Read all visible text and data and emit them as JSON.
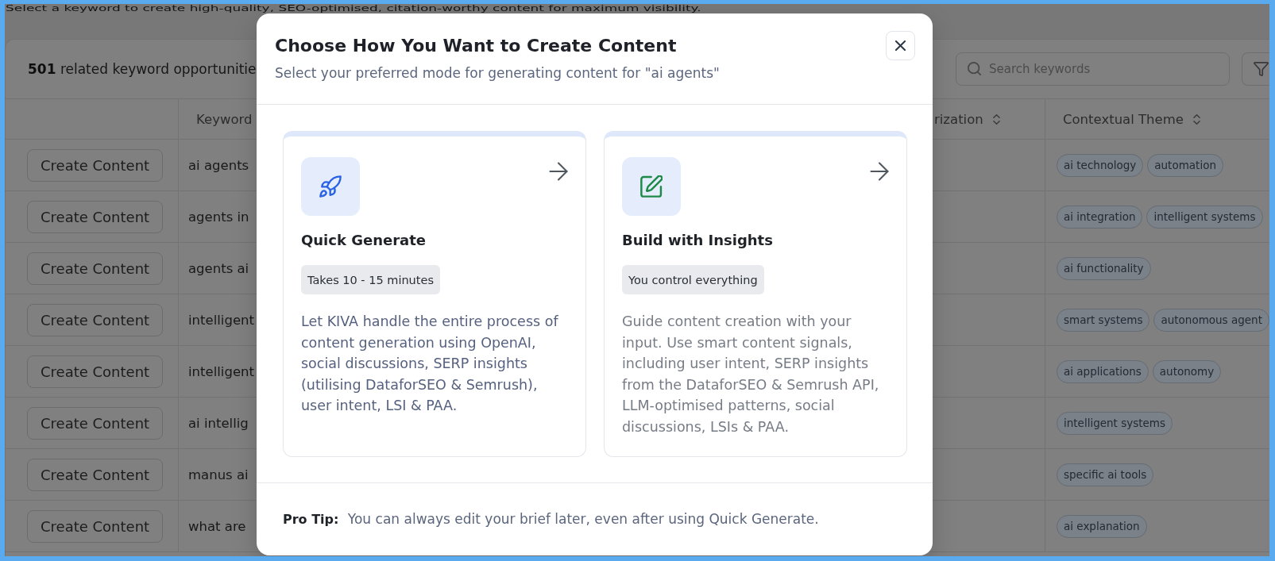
{
  "intro": "Select a keyword to create high-quality, SEO-optimised, citation-worthy content for maximum visibility.",
  "keywords_panel": {
    "summary": "**501** related keyword opportunitie",
    "search": {
      "placeholder": "Search keywords"
    },
    "columns": [
      {
        "kind": "plain",
        "label": "Keyword"
      },
      {
        "kind": "sortable",
        "label": "rization"
      },
      {
        "kind": "sortable",
        "label": "Contextual Theme"
      }
    ],
    "rows": [
      {
        "action": "Create Content",
        "keyword": "ai agents",
        "themes": [
          "ai technology",
          "automation"
        ]
      },
      {
        "action": "Create Content",
        "keyword": "agents in",
        "themes": [
          "ai integration",
          "intelligent systems"
        ]
      },
      {
        "action": "Create Content",
        "keyword": "agents ai",
        "themes": [
          "ai functionality"
        ]
      },
      {
        "action": "Create Content",
        "keyword": "intelligent",
        "themes": [
          "smart systems",
          "autonomous agent"
        ]
      },
      {
        "action": "Create Content",
        "keyword": "intelligent",
        "themes": [
          "ai applications",
          "autonomy"
        ]
      },
      {
        "action": "Create Content",
        "keyword": "ai intellig",
        "themes": [
          "intelligent systems"
        ]
      },
      {
        "action": "Create Content",
        "keyword": "manus ai",
        "themes": [
          "specific ai tools"
        ]
      },
      {
        "action": "Create Content",
        "keyword": "what are",
        "themes": [
          "ai explanation"
        ]
      }
    ]
  },
  "dialog": {
    "title": "Choose How You Want to Create Content",
    "subtitle": "Select your preferred mode for generating content for \"ai agents\"",
    "options": [
      {
        "kind": "quick",
        "title": "Quick Generate",
        "badge": "Takes 10 - 15 minutes",
        "description": "Let KIVA handle the entire process of\ncontent generation using OpenAI,\nsocial discussions, SERP insights\n(utilising DataforSEO & Semrush),\nuser intent, LSI & PAA.",
        "highlighted": true
      },
      {
        "kind": "guided",
        "title": "Build with Insights",
        "badge": "You control everything",
        "description": "Guide content creation with your\ninput. Use smart content signals,\nincluding user intent, SERP insights\nfrom the DataforSEO & Semrush API,\nLLM-optimised patterns, social\ndiscussions, LSIs & PAA.",
        "highlighted": false
      }
    ],
    "tip": "**Pro Tip:** You can always edit your brief later, even after using Quick Generate."
  }
}
